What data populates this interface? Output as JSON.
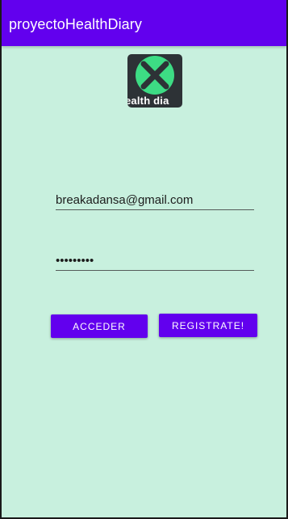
{
  "app": {
    "title": "proyectoHealthDiary",
    "colors": {
      "app_bar": "#6200ee",
      "background": "#c8f0de",
      "button": "#6200ee",
      "logo_accent": "#3ddc84"
    }
  },
  "logo": {
    "icon": "x-circle-logo-icon",
    "text": "ealth dia"
  },
  "form": {
    "email_value": "breakadansa@gmail.com",
    "password_value": "•••••••••",
    "acceder_label": "ACCEDER",
    "registrate_label": "REGISTRATE!"
  }
}
